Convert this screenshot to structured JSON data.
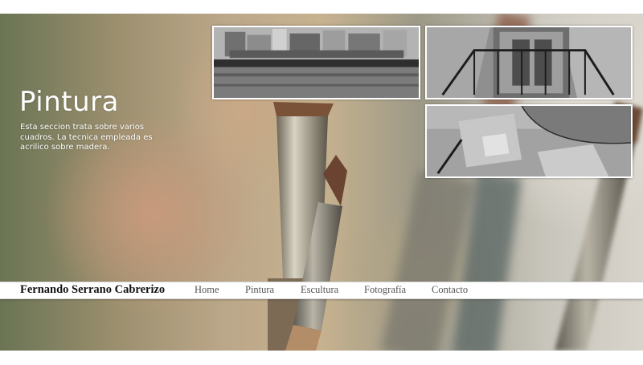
{
  "section": {
    "title": "Pintura",
    "description": "Esta seccion trata sobre varios cuadros. La tecnica empleada es acrilico sobre madera."
  },
  "gallery": {
    "images": [
      {
        "subject": "gray blocks wall painting"
      },
      {
        "subject": "window with iron bars painting"
      },
      {
        "subject": "abstract gray shapes painting"
      }
    ]
  },
  "navbar": {
    "brand": "Fernando Serrano Cabrerizo",
    "links": [
      "Home",
      "Pintura",
      "Escultura",
      "Fotografía",
      "Contacto"
    ]
  },
  "colors": {
    "nav_background": "#ffffff",
    "heading_text": "#ffffff",
    "brand_text": "#111111",
    "link_text": "#555555"
  }
}
